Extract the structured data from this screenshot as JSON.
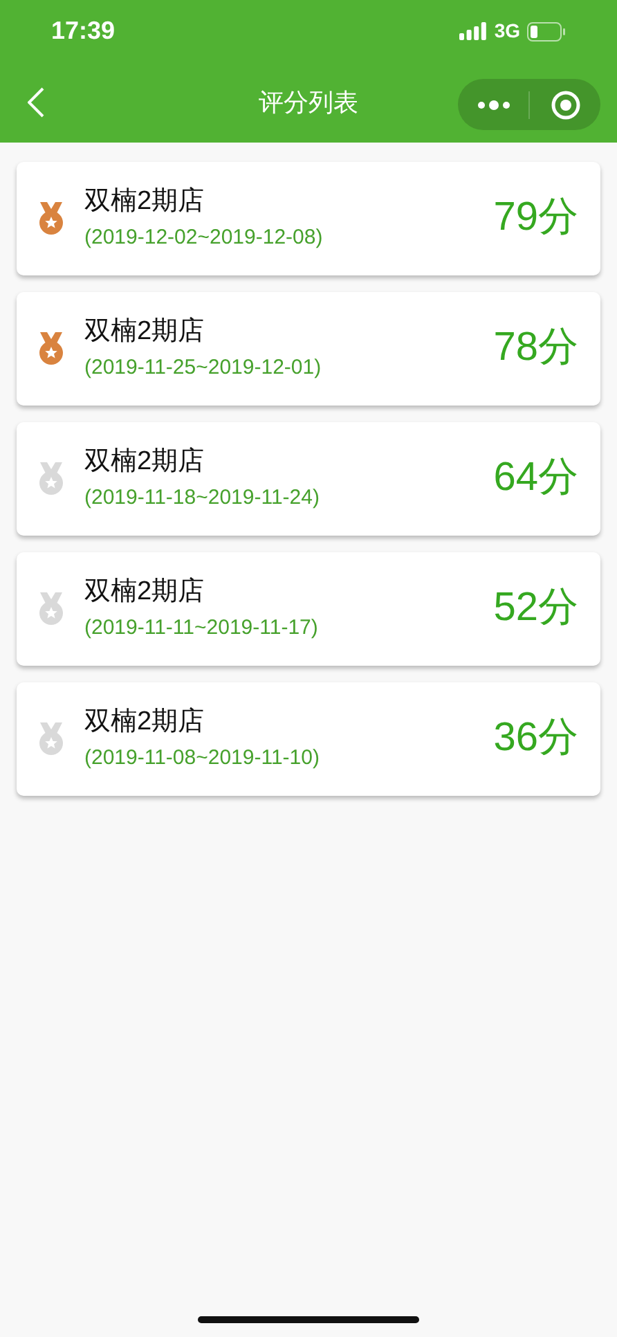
{
  "status_bar": {
    "time": "17:39",
    "network": "3G"
  },
  "nav": {
    "title": "评分列表"
  },
  "items": [
    {
      "store": "双楠2期店",
      "period": "(2019-12-02~2019-12-08)",
      "score": "79分",
      "medal": true
    },
    {
      "store": "双楠2期店",
      "period": "(2019-11-25~2019-12-01)",
      "score": "78分",
      "medal": true
    },
    {
      "store": "双楠2期店",
      "period": "(2019-11-18~2019-11-24)",
      "score": "64分",
      "medal": false
    },
    {
      "store": "双楠2期店",
      "period": "(2019-11-11~2019-11-17)",
      "score": "52分",
      "medal": false
    },
    {
      "store": "双楠2期店",
      "period": "(2019-11-08~2019-11-10)",
      "score": "36分",
      "medal": false
    }
  ]
}
